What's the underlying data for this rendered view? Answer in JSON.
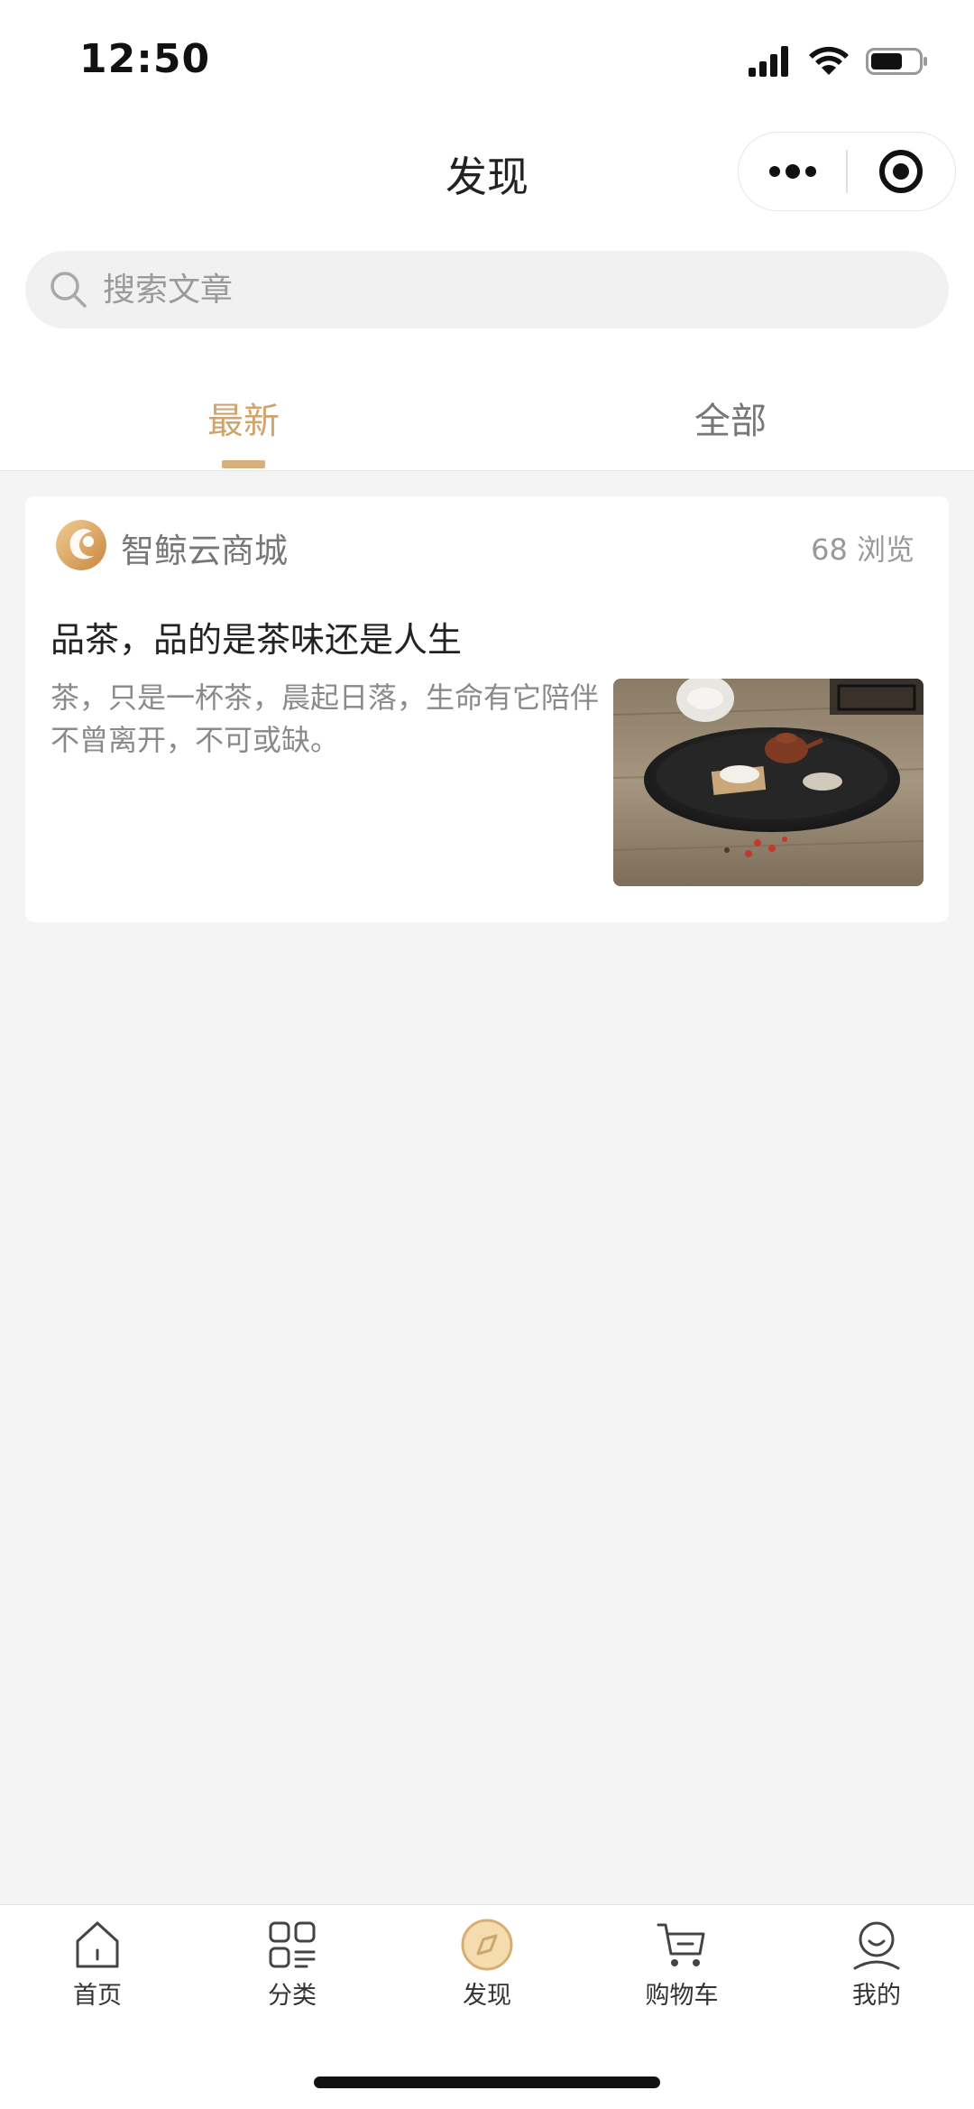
{
  "status_bar": {
    "time": "12:50"
  },
  "nav": {
    "title": "发现"
  },
  "search": {
    "placeholder": "搜索文章"
  },
  "tabs": [
    {
      "label": "最新",
      "active": true
    },
    {
      "label": "全部",
      "active": false
    }
  ],
  "article": {
    "source": "智鲸云商城",
    "views": "68 浏览",
    "title": "品茶，品的是茶味还是人生",
    "summary": "茶，只是一杯茶，晨起日落，生命有它陪伴不曾离开，不可或缺。"
  },
  "tabbar": {
    "items": [
      {
        "label": "首页",
        "icon": "home-icon"
      },
      {
        "label": "分类",
        "icon": "category-icon"
      },
      {
        "label": "发现",
        "icon": "compass-icon",
        "active": true
      },
      {
        "label": "购物车",
        "icon": "cart-icon"
      },
      {
        "label": "我的",
        "icon": "profile-icon"
      }
    ]
  },
  "colors": {
    "accent": "#cfa56f",
    "background": "#f4f4f4"
  }
}
